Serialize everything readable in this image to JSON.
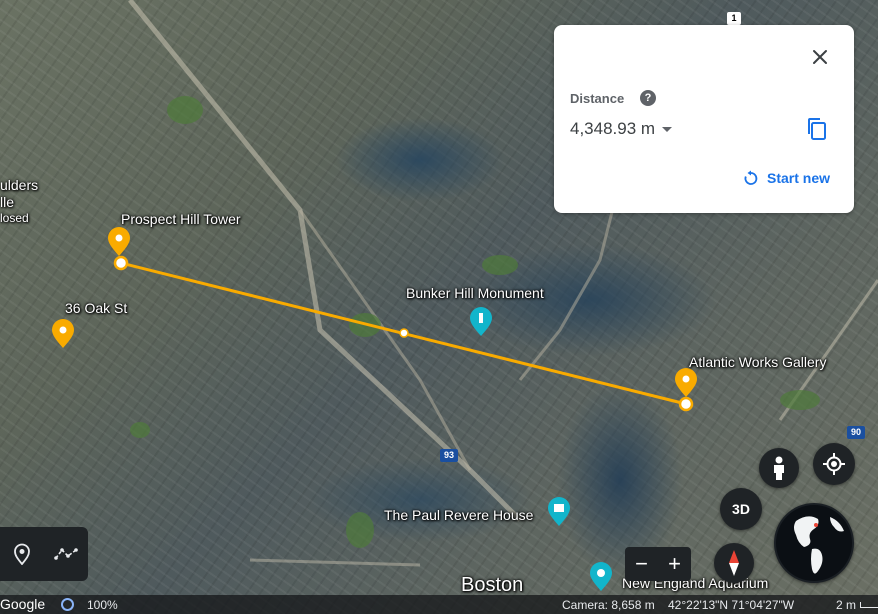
{
  "map": {
    "labels": {
      "prospect_hill": "Prospect Hill Tower",
      "oak_st": "36 Oak St",
      "bunker_hill": "Bunker Hill Monument",
      "atlantic_works": "Atlantic Works Gallery",
      "paul_revere": "The Paul Revere House",
      "ne_aquarium": "New England Aquarium",
      "boston": "Boston",
      "boulders_1": "ulders",
      "boulders_2": "lle",
      "boulders_3": "losed",
      "route_1": "1",
      "route_93": "93",
      "route_90": "90"
    }
  },
  "distance_panel": {
    "title": "Distance",
    "help": "?",
    "value": "4,348.93 m",
    "start_new": "Start new"
  },
  "controls": {
    "btn_3d": "3D",
    "zoom_out": "−",
    "zoom_in": "+"
  },
  "status": {
    "logo": "Google",
    "load": "100%",
    "camera": "Camera: 8,658 m",
    "coords": "42°22'13\"N 71°04'27\"W",
    "scale": "2 m"
  },
  "colors": {
    "measure_line": "#f9ab00",
    "pin": "#f9ab00",
    "accent": "#1a73e8",
    "place_teal": "#12b5cb"
  }
}
